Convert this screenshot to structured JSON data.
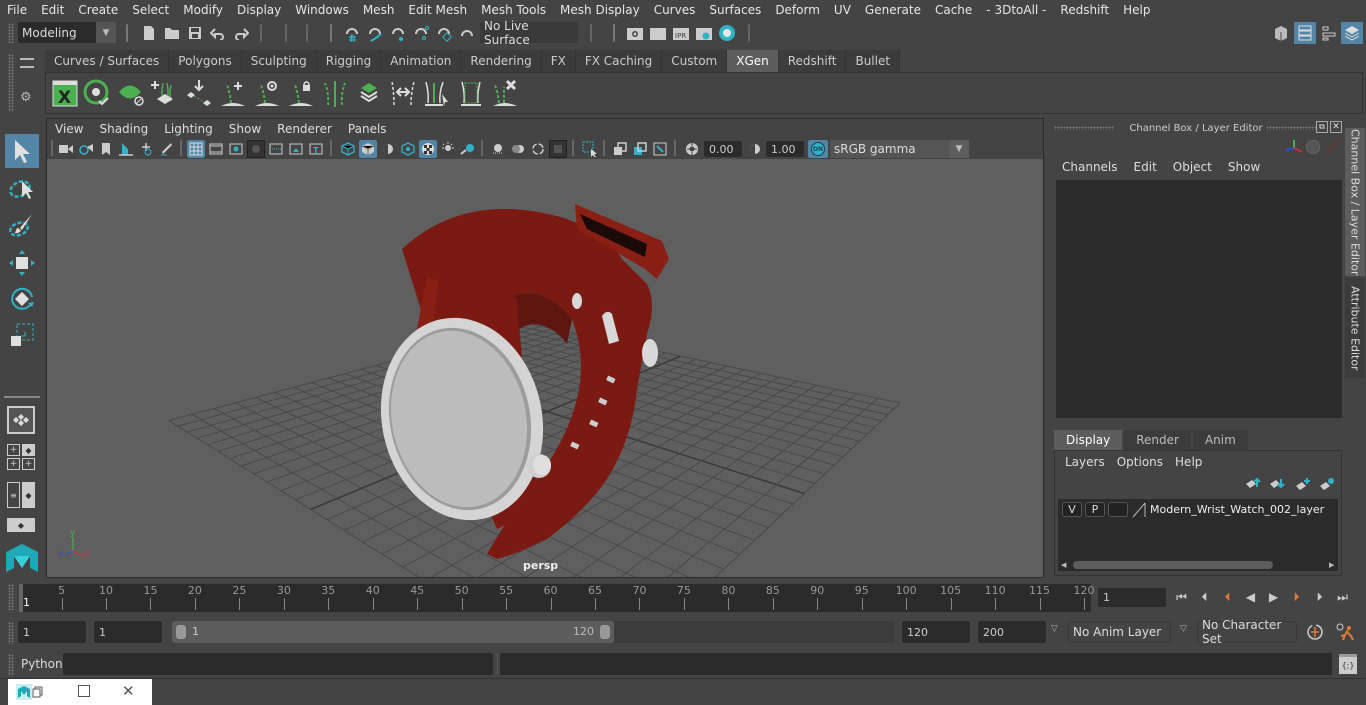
{
  "menubar": {
    "items": [
      "File",
      "Edit",
      "Create",
      "Select",
      "Modify",
      "Display",
      "Windows",
      "Mesh",
      "Edit Mesh",
      "Mesh Tools",
      "Mesh Display",
      "Curves",
      "Surfaces",
      "Deform",
      "UV",
      "Generate",
      "Cache",
      "- 3DtoAll -",
      "Redshift",
      "Help"
    ]
  },
  "statusline": {
    "mode_select": "Modeling",
    "live_surface": "No Live Surface",
    "icons": [
      "new-scene-icon",
      "open-scene-icon",
      "save-scene-icon",
      "undo-icon",
      "redo-icon",
      "snap-grid-icon",
      "snap-curve-icon",
      "snap-point-icon",
      "snap-view-plane-icon",
      "snap-live-icon",
      "snap-magnet-icon",
      "render-view-icon",
      "render-current-icon",
      "ipr-render-icon",
      "render-settings-icon",
      "hypershade-icon"
    ],
    "right_icons": [
      "modeling-toolkit-icon",
      "attribute-editor-icon",
      "tool-settings-icon",
      "channel-box-icon"
    ]
  },
  "shelf": {
    "tabs": [
      "Curves / Surfaces",
      "Polygons",
      "Sculpting",
      "Rigging",
      "Animation",
      "Rendering",
      "FX",
      "FX Caching",
      "Custom",
      "XGen",
      "Redshift",
      "Bullet"
    ],
    "active_tab": "XGen",
    "icons": [
      "xgen-editor-icon",
      "xgen-preview-icon",
      "xgen-clear-preview-icon",
      "xgen-add-description-icon",
      "xgen-place-guides-icon",
      "xgen-add-guide-icon",
      "xgen-guide-visibility-icon",
      "xgen-lock-guides-icon",
      "xgen-guides-to-curves-icon",
      "xgen-interactive-groom-icon",
      "xgen-flip-guides-icon",
      "xgen-select-guides-icon",
      "xgen-guides-bbox-icon",
      "xgen-delete-guides-icon"
    ]
  },
  "toolbox": {
    "tools": [
      "select-tool-icon",
      "lasso-tool-icon",
      "paint-select-tool-icon",
      "move-tool-icon",
      "rotate-tool-icon",
      "scale-tool-icon"
    ],
    "layouts": [
      "single-perspective-layout-icon",
      "four-view-layout-icon",
      "outliner-persp-layout-icon",
      "persp-graph-layout-icon"
    ]
  },
  "viewport": {
    "menu": [
      "View",
      "Shading",
      "Lighting",
      "Show",
      "Renderer",
      "Panels"
    ],
    "exposure": "0.00",
    "gamma": "1.00",
    "color_management": "ON",
    "color_space": "sRGB gamma",
    "camera_label": "persp",
    "axis": {
      "x": "x",
      "y": "y",
      "z": "z"
    },
    "model_colors": {
      "strap": "#7a1a12",
      "bezel": "#d4d4d4",
      "face": "#b8b8b8"
    }
  },
  "channel_box": {
    "title": "Channel Box / Layer Editor",
    "menu": [
      "Channels",
      "Edit",
      "Object",
      "Show"
    ]
  },
  "layer_editor": {
    "tabs": [
      "Display",
      "Render",
      "Anim"
    ],
    "active_tab": "Display",
    "menu": [
      "Layers",
      "Options",
      "Help"
    ],
    "layers": [
      {
        "visible": "V",
        "playback": "P",
        "name": "Modern_Wrist_Watch_002_layer"
      }
    ]
  },
  "side_tabs": [
    "Channel Box / Layer Editor",
    "Attribute Editor"
  ],
  "timeline": {
    "ticks": [
      5,
      10,
      15,
      20,
      25,
      30,
      35,
      40,
      45,
      50,
      55,
      60,
      65,
      70,
      75,
      80,
      85,
      90,
      95,
      100,
      105,
      110,
      115,
      120
    ],
    "start_frame_label": "1",
    "range_max": 120,
    "current_frame": "1"
  },
  "playback": {
    "buttons": [
      "go-to-start-icon",
      "step-back-frame-icon",
      "step-back-key-icon",
      "play-backwards-icon",
      "play-forwards-icon",
      "step-forward-key-icon",
      "step-forward-frame-icon",
      "go-to-end-icon"
    ]
  },
  "range": {
    "start": "1",
    "playback_start": "1",
    "slider_start": "1",
    "slider_end": "120",
    "playback_end": "120",
    "end": "200",
    "anim_layer": "No Anim Layer",
    "character_set": "No Character Set"
  },
  "cmdline": {
    "language": "Python"
  },
  "colors": {
    "accent": "#5285a6",
    "teal": "#30b3c7",
    "xgen_green": "#4caf50",
    "key_orange": "#e07b39"
  }
}
